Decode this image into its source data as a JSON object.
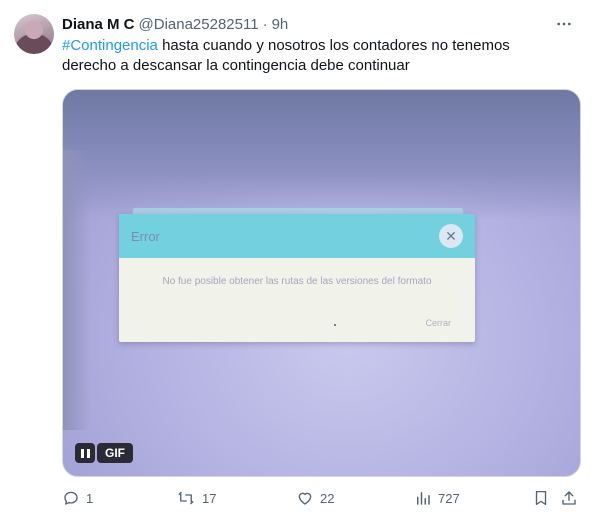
{
  "tweet": {
    "author_name": "Diana M C",
    "handle": "@Diana25282511",
    "separator": "·",
    "time": "9h",
    "more_icon": "more-icon",
    "hashtag": "#Contingencia",
    "text_rest": " hasta cuando y nosotros los contadores no tenemos derecho a descansar la contingencia debe continuar"
  },
  "media": {
    "dialog_title": "Error",
    "dialog_message": "No fue posible obtener las rutas de las versiones del formato",
    "dialog_button": "Cerrar",
    "gif_label": "GIF",
    "pause_icon": "pause-icon"
  },
  "actions": {
    "replies": "1",
    "reposts": "17",
    "likes": "22",
    "views": "727"
  },
  "colors": {
    "accent": "#1d9bf0",
    "secondary_text": "#536471",
    "dialog_header": "#73d0de"
  }
}
